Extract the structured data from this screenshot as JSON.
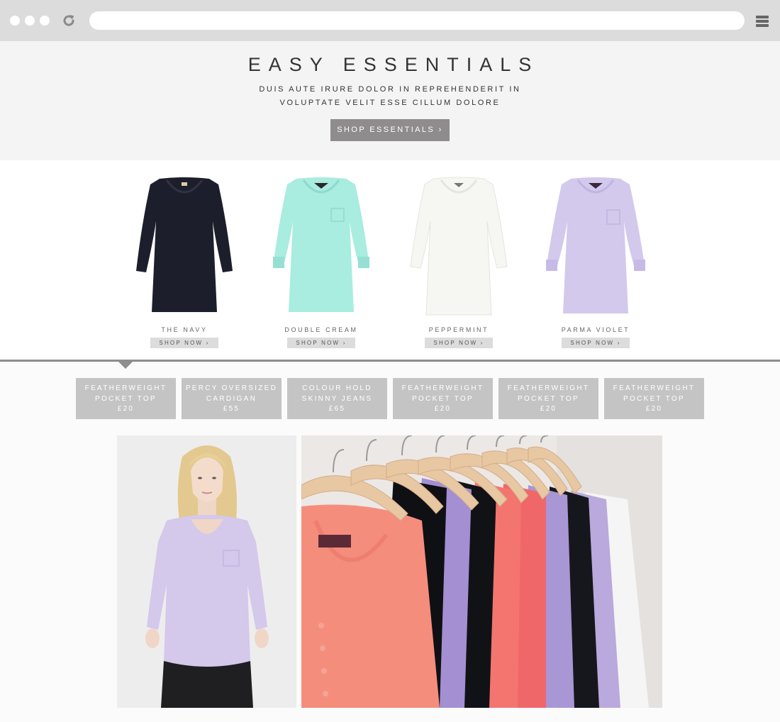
{
  "browser": {
    "icons": [
      "window-dot",
      "reload-icon",
      "menu-icon"
    ]
  },
  "hero": {
    "title": "EASY ESSENTIALS",
    "subtitle_line1": "DUIS AUTE IRURE DOLOR IN REPREHENDERIT IN",
    "subtitle_line2": "VOLUPTATE VELIT ESSE CILLUM DOLORE",
    "button_label": "SHOP ESSENTIALS ›"
  },
  "products": [
    {
      "name": "THE NAVY",
      "button": "SHOP NOW ›",
      "color": "#1c1f2b"
    },
    {
      "name": "DOUBLE CREAM",
      "button": "SHOP NOW ›",
      "color": "#a9ece0"
    },
    {
      "name": "PEPPERMINT",
      "button": "SHOP NOW ›",
      "color": "#f6f6f3"
    },
    {
      "name": "PARMA VIOLET",
      "button": "SHOP NOW ›",
      "color": "#d3c9ec"
    }
  ],
  "tabs": [
    {
      "line1": "FEATHERWEIGHT",
      "line2": "POCKET TOP",
      "price": "£20"
    },
    {
      "line1": "PERCY OVERSIZED",
      "line2": "CARDIGAN",
      "price": "£55"
    },
    {
      "line1": "COLOUR HOLD",
      "line2": "SKINNY JEANS",
      "price": "£65"
    },
    {
      "line1": "FEATHERWEIGHT",
      "line2": "POCKET TOP",
      "price": "£20"
    },
    {
      "line1": "FEATHERWEIGHT",
      "line2": "POCKET TOP",
      "price": "£20"
    },
    {
      "line1": "FEATHERWEIGHT",
      "line2": "POCKET TOP",
      "price": "£20"
    }
  ],
  "colors": {
    "chrome": "#dcdcdc",
    "hero_bg": "#f4f4f4",
    "hero_button": "#8e8c8d",
    "tab_bg": "#c4c4c4",
    "divider": "#8e8e8e"
  }
}
